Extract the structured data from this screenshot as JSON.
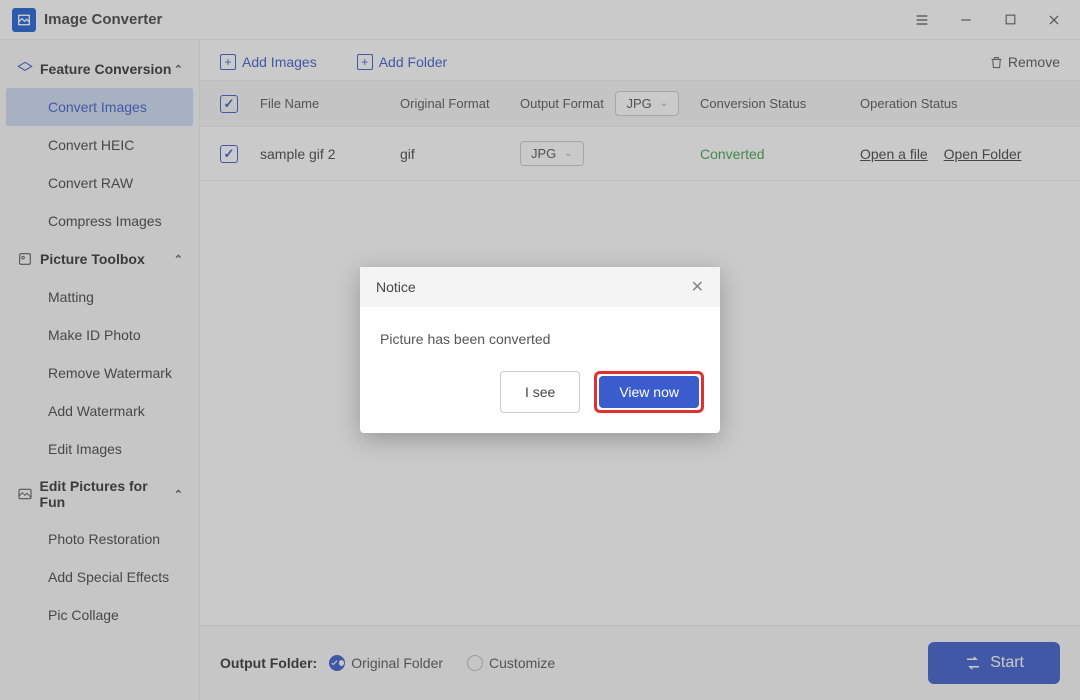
{
  "app": {
    "title": "Image Converter"
  },
  "sidebar": {
    "group1": {
      "label": "Feature Conversion",
      "items": [
        "Convert Images",
        "Convert HEIC",
        "Convert RAW",
        "Compress Images"
      ],
      "selected": 0
    },
    "group2": {
      "label": "Picture Toolbox",
      "items": [
        "Matting",
        "Make ID Photo",
        "Remove Watermark",
        "Add Watermark",
        "Edit Images"
      ]
    },
    "group3": {
      "label": "Edit Pictures for Fun",
      "items": [
        "Photo Restoration",
        "Add Special Effects",
        "Pic Collage"
      ]
    }
  },
  "toolbar": {
    "add_images": "Add Images",
    "add_folder": "Add Folder",
    "remove": "Remove"
  },
  "table": {
    "headers": {
      "file_name": "File Name",
      "original_format": "Original Format",
      "output_format": "Output Format",
      "conversion_status": "Conversion Status",
      "operation_status": "Operation Status"
    },
    "header_output_value": "JPG",
    "rows": [
      {
        "name": "sample gif 2",
        "original": "gif",
        "output": "JPG",
        "status": "Converted",
        "op_open_file": "Open a file",
        "op_open_folder": "Open Folder"
      }
    ]
  },
  "footer": {
    "label": "Output Folder:",
    "opt_original": "Original Folder",
    "opt_custom": "Customize",
    "selected": "original",
    "start": "Start"
  },
  "modal": {
    "title": "Notice",
    "message": "Picture has been converted",
    "btn_secondary": "I see",
    "btn_primary": "View now"
  }
}
